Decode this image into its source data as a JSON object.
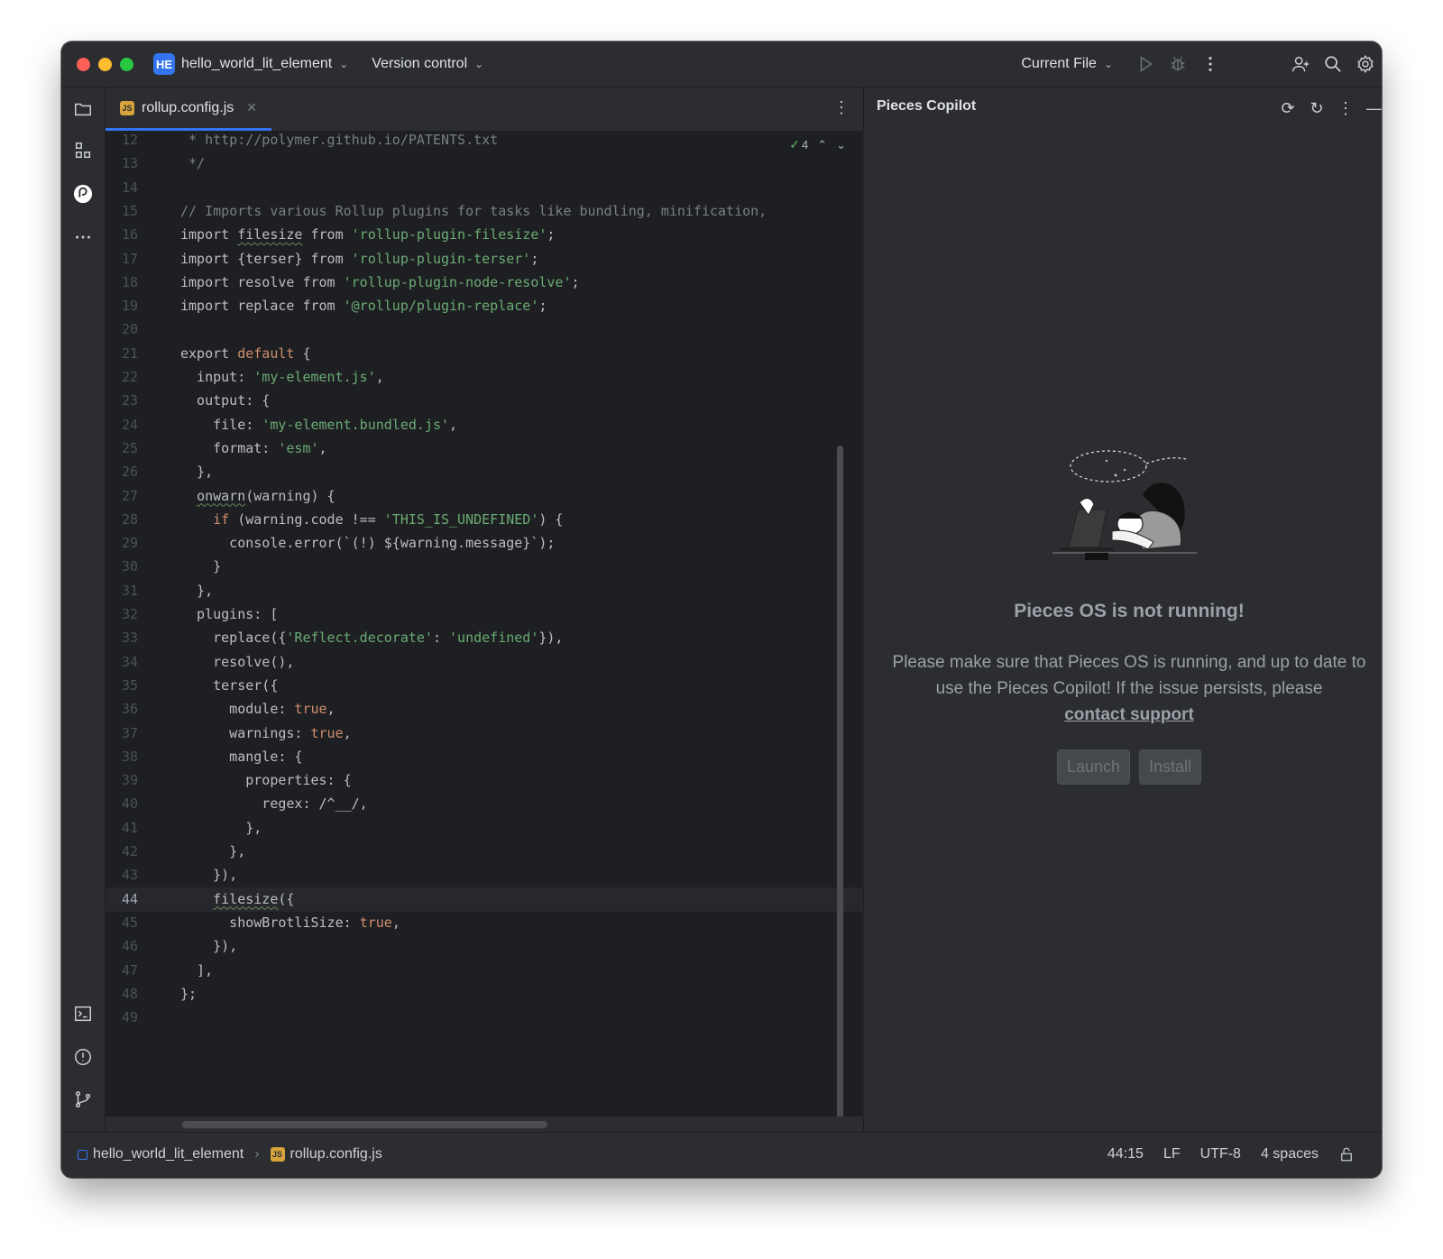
{
  "titlebar": {
    "project_badge": "HE",
    "project_name": "hello_world_lit_element",
    "vcs_label": "Version control",
    "run_config": "Current File"
  },
  "editor": {
    "tab_label": "rollup.config.js",
    "tab_badge": "JS",
    "inspection_count": "4",
    "current_line": 44,
    "lines": [
      {
        "n": "12",
        "t": " * http://polymer.github.io/PATENTS.txt"
      },
      {
        "n": "13",
        "t": " */"
      },
      {
        "n": "14",
        "t": ""
      },
      {
        "n": "15",
        "t": "// Imports various Rollup plugins for tasks like bundling, minification,"
      },
      {
        "n": "16",
        "t": "import filesize from 'rollup-plugin-filesize';"
      },
      {
        "n": "17",
        "t": "import {terser} from 'rollup-plugin-terser';"
      },
      {
        "n": "18",
        "t": "import resolve from 'rollup-plugin-node-resolve';"
      },
      {
        "n": "19",
        "t": "import replace from '@rollup/plugin-replace';"
      },
      {
        "n": "20",
        "t": ""
      },
      {
        "n": "21",
        "t": "export default {"
      },
      {
        "n": "22",
        "t": "  input: 'my-element.js',"
      },
      {
        "n": "23",
        "t": "  output: {"
      },
      {
        "n": "24",
        "t": "    file: 'my-element.bundled.js',"
      },
      {
        "n": "25",
        "t": "    format: 'esm',"
      },
      {
        "n": "26",
        "t": "  },"
      },
      {
        "n": "27",
        "t": "  onwarn(warning) {"
      },
      {
        "n": "28",
        "t": "    if (warning.code !== 'THIS_IS_UNDEFINED') {"
      },
      {
        "n": "29",
        "t": "      console.error(`(!) ${warning.message}`);"
      },
      {
        "n": "30",
        "t": "    }"
      },
      {
        "n": "31",
        "t": "  },"
      },
      {
        "n": "32",
        "t": "  plugins: ["
      },
      {
        "n": "33",
        "t": "    replace({'Reflect.decorate': 'undefined'}),"
      },
      {
        "n": "34",
        "t": "    resolve(),"
      },
      {
        "n": "35",
        "t": "    terser({"
      },
      {
        "n": "36",
        "t": "      module: true,"
      },
      {
        "n": "37",
        "t": "      warnings: true,"
      },
      {
        "n": "38",
        "t": "      mangle: {"
      },
      {
        "n": "39",
        "t": "        properties: {"
      },
      {
        "n": "40",
        "t": "          regex: /^__/,"
      },
      {
        "n": "41",
        "t": "        },"
      },
      {
        "n": "42",
        "t": "      },"
      },
      {
        "n": "43",
        "t": "    }),"
      },
      {
        "n": "44",
        "t": "    filesize({"
      },
      {
        "n": "45",
        "t": "      showBrotliSize: true,"
      },
      {
        "n": "46",
        "t": "    }),"
      },
      {
        "n": "47",
        "t": "  ],"
      },
      {
        "n": "48",
        "t": "};"
      },
      {
        "n": "49",
        "t": ""
      }
    ]
  },
  "panel": {
    "title": "Pieces Copilot",
    "empty_title": "Pieces OS is not running!",
    "empty_message": "Please make sure that Pieces OS is running, and up to date to use the Pieces Copilot! If the issue persists, please",
    "support_link": "contact support",
    "launch_label": "Launch",
    "install_label": "Install"
  },
  "statusbar": {
    "project": "hello_world_lit_element",
    "file": "rollup.config.js",
    "file_badge": "JS",
    "position": "44:15",
    "line_ending": "LF",
    "encoding": "UTF-8",
    "indent": "4 spaces"
  },
  "colors": {
    "accent": "#3574f0",
    "keyword": "#cf8e6d",
    "string": "#6aab73",
    "comment": "#7a7e85"
  }
}
